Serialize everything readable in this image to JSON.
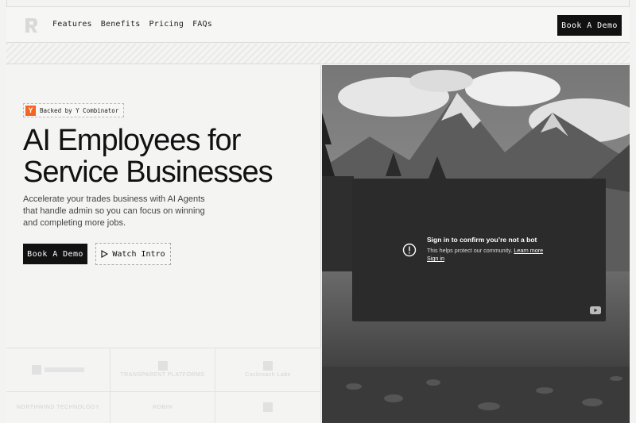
{
  "header": {
    "nav": [
      "Features",
      "Benefits",
      "Pricing",
      "FAQs"
    ],
    "cta": "Book A Demo"
  },
  "hero": {
    "badge_letter": "Y",
    "badge_text": "Backed by Y Combinator",
    "title_line1": "AI Employees for",
    "title_line2": "Service Businesses",
    "subtitle": "Accelerate your trades business with AI Agents that handle admin so you can focus on winning and completing more jobs.",
    "primary_button": "Book A Demo",
    "secondary_button": "Watch Intro"
  },
  "logos": {
    "cells": [
      "",
      "TRANSPARENT PLATFORMS",
      "Cockroach Labs",
      "NORTHWIND TECHNOLOGY",
      "ROBIN",
      ""
    ]
  },
  "video": {
    "title": "Sign in to confirm you’re not a bot",
    "message": "This helps protect our community.",
    "learn_more": "Learn more",
    "sign_in": "Sign in"
  },
  "colors": {
    "accent_yc": "#f26522",
    "dark": "#111111",
    "overlay": "#2b2b2b"
  }
}
